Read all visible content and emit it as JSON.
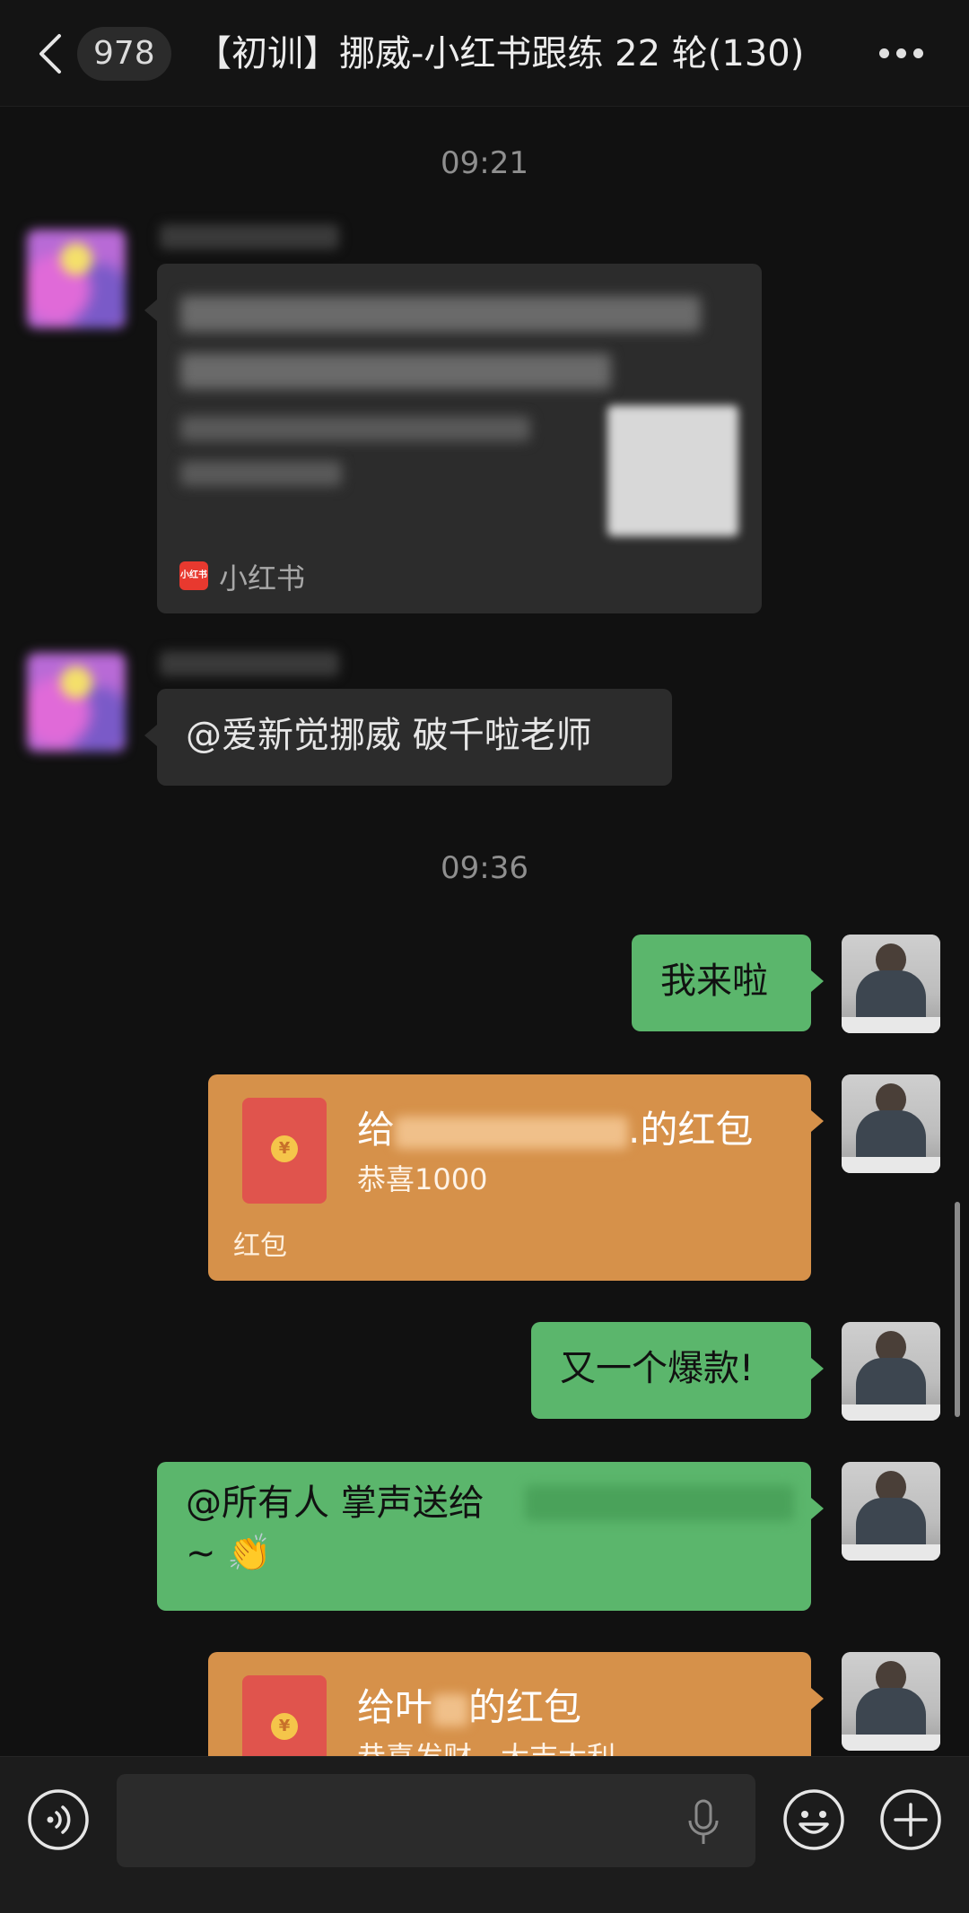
{
  "header": {
    "unread_count": "978",
    "title": "【初训】挪威-小红书跟练 22 轮(130)"
  },
  "timestamps": [
    "09:21",
    "09:36"
  ],
  "messages": {
    "share_card": {
      "source": "小红书",
      "source_logo_text": "小红书"
    },
    "mention_text": "@爱新觉挪威 破千啦老师",
    "self_1": "我来啦",
    "redpacket_1": {
      "title_prefix": "给",
      "title_suffix": ".的红包",
      "subtitle": "恭喜1000",
      "label": "红包"
    },
    "self_2": "又一个爆款!",
    "self_3": {
      "text": "@所有人 掌声送给",
      "line2": "~ 👏"
    },
    "redpacket_2": {
      "title_prefix": "给叶",
      "title_suffix": "的红包",
      "subtitle": "恭喜发财，大吉大利"
    }
  },
  "icons": {
    "back": "chevron-left-icon",
    "more": "more-dots-icon",
    "voice": "voice-icon",
    "mic": "mic-icon",
    "emoji": "emoji-icon",
    "plus": "plus-icon"
  }
}
